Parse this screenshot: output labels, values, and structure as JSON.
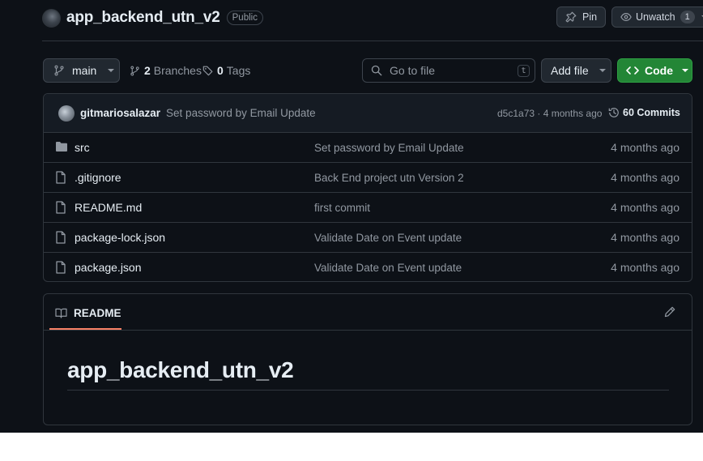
{
  "repo": {
    "name": "app_backend_utn_v2",
    "visibility": "Public",
    "pin_label": "Pin",
    "watch_label": "Unwatch",
    "watch_count": "1"
  },
  "toolbar": {
    "branch": "main",
    "branches_count": "2",
    "branches_label": "Branches",
    "tags_count": "0",
    "tags_label": "Tags",
    "search_placeholder": "Go to file",
    "search_shortcut": "t",
    "add_file_label": "Add file",
    "code_label": "Code"
  },
  "latest_commit": {
    "author": "gitmariosalazar",
    "message": "Set password by Email Update",
    "meta": "d5c1a73 · 4 months ago",
    "commits_label": "60 Commits"
  },
  "files": [
    {
      "name": "src",
      "type": "folder",
      "message": "Set password by Email Update",
      "date": "4 months ago"
    },
    {
      "name": ".gitignore",
      "type": "file",
      "message": "Back End project utn Version 2",
      "date": "4 months ago"
    },
    {
      "name": "README.md",
      "type": "file",
      "message": "first commit",
      "date": "4 months ago"
    },
    {
      "name": "package-lock.json",
      "type": "file",
      "message": "Validate Date on Event update",
      "date": "4 months ago"
    },
    {
      "name": "package.json",
      "type": "file",
      "message": "Validate Date on Event update",
      "date": "4 months ago"
    }
  ],
  "readme": {
    "tab_label": "README",
    "title": "app_backend_utn_v2"
  },
  "colors": {
    "background": "#0d1117",
    "border": "#30363d",
    "muted_text": "#9198a1",
    "code_button": "#238636",
    "tab_underline": "#f78166"
  },
  "icons": [
    "repo-avatar",
    "pin-icon",
    "eye-icon",
    "branch-icon",
    "tag-icon",
    "search-icon",
    "code-icon",
    "history-icon",
    "folder-icon",
    "file-icon",
    "book-icon",
    "pencil-icon"
  ]
}
